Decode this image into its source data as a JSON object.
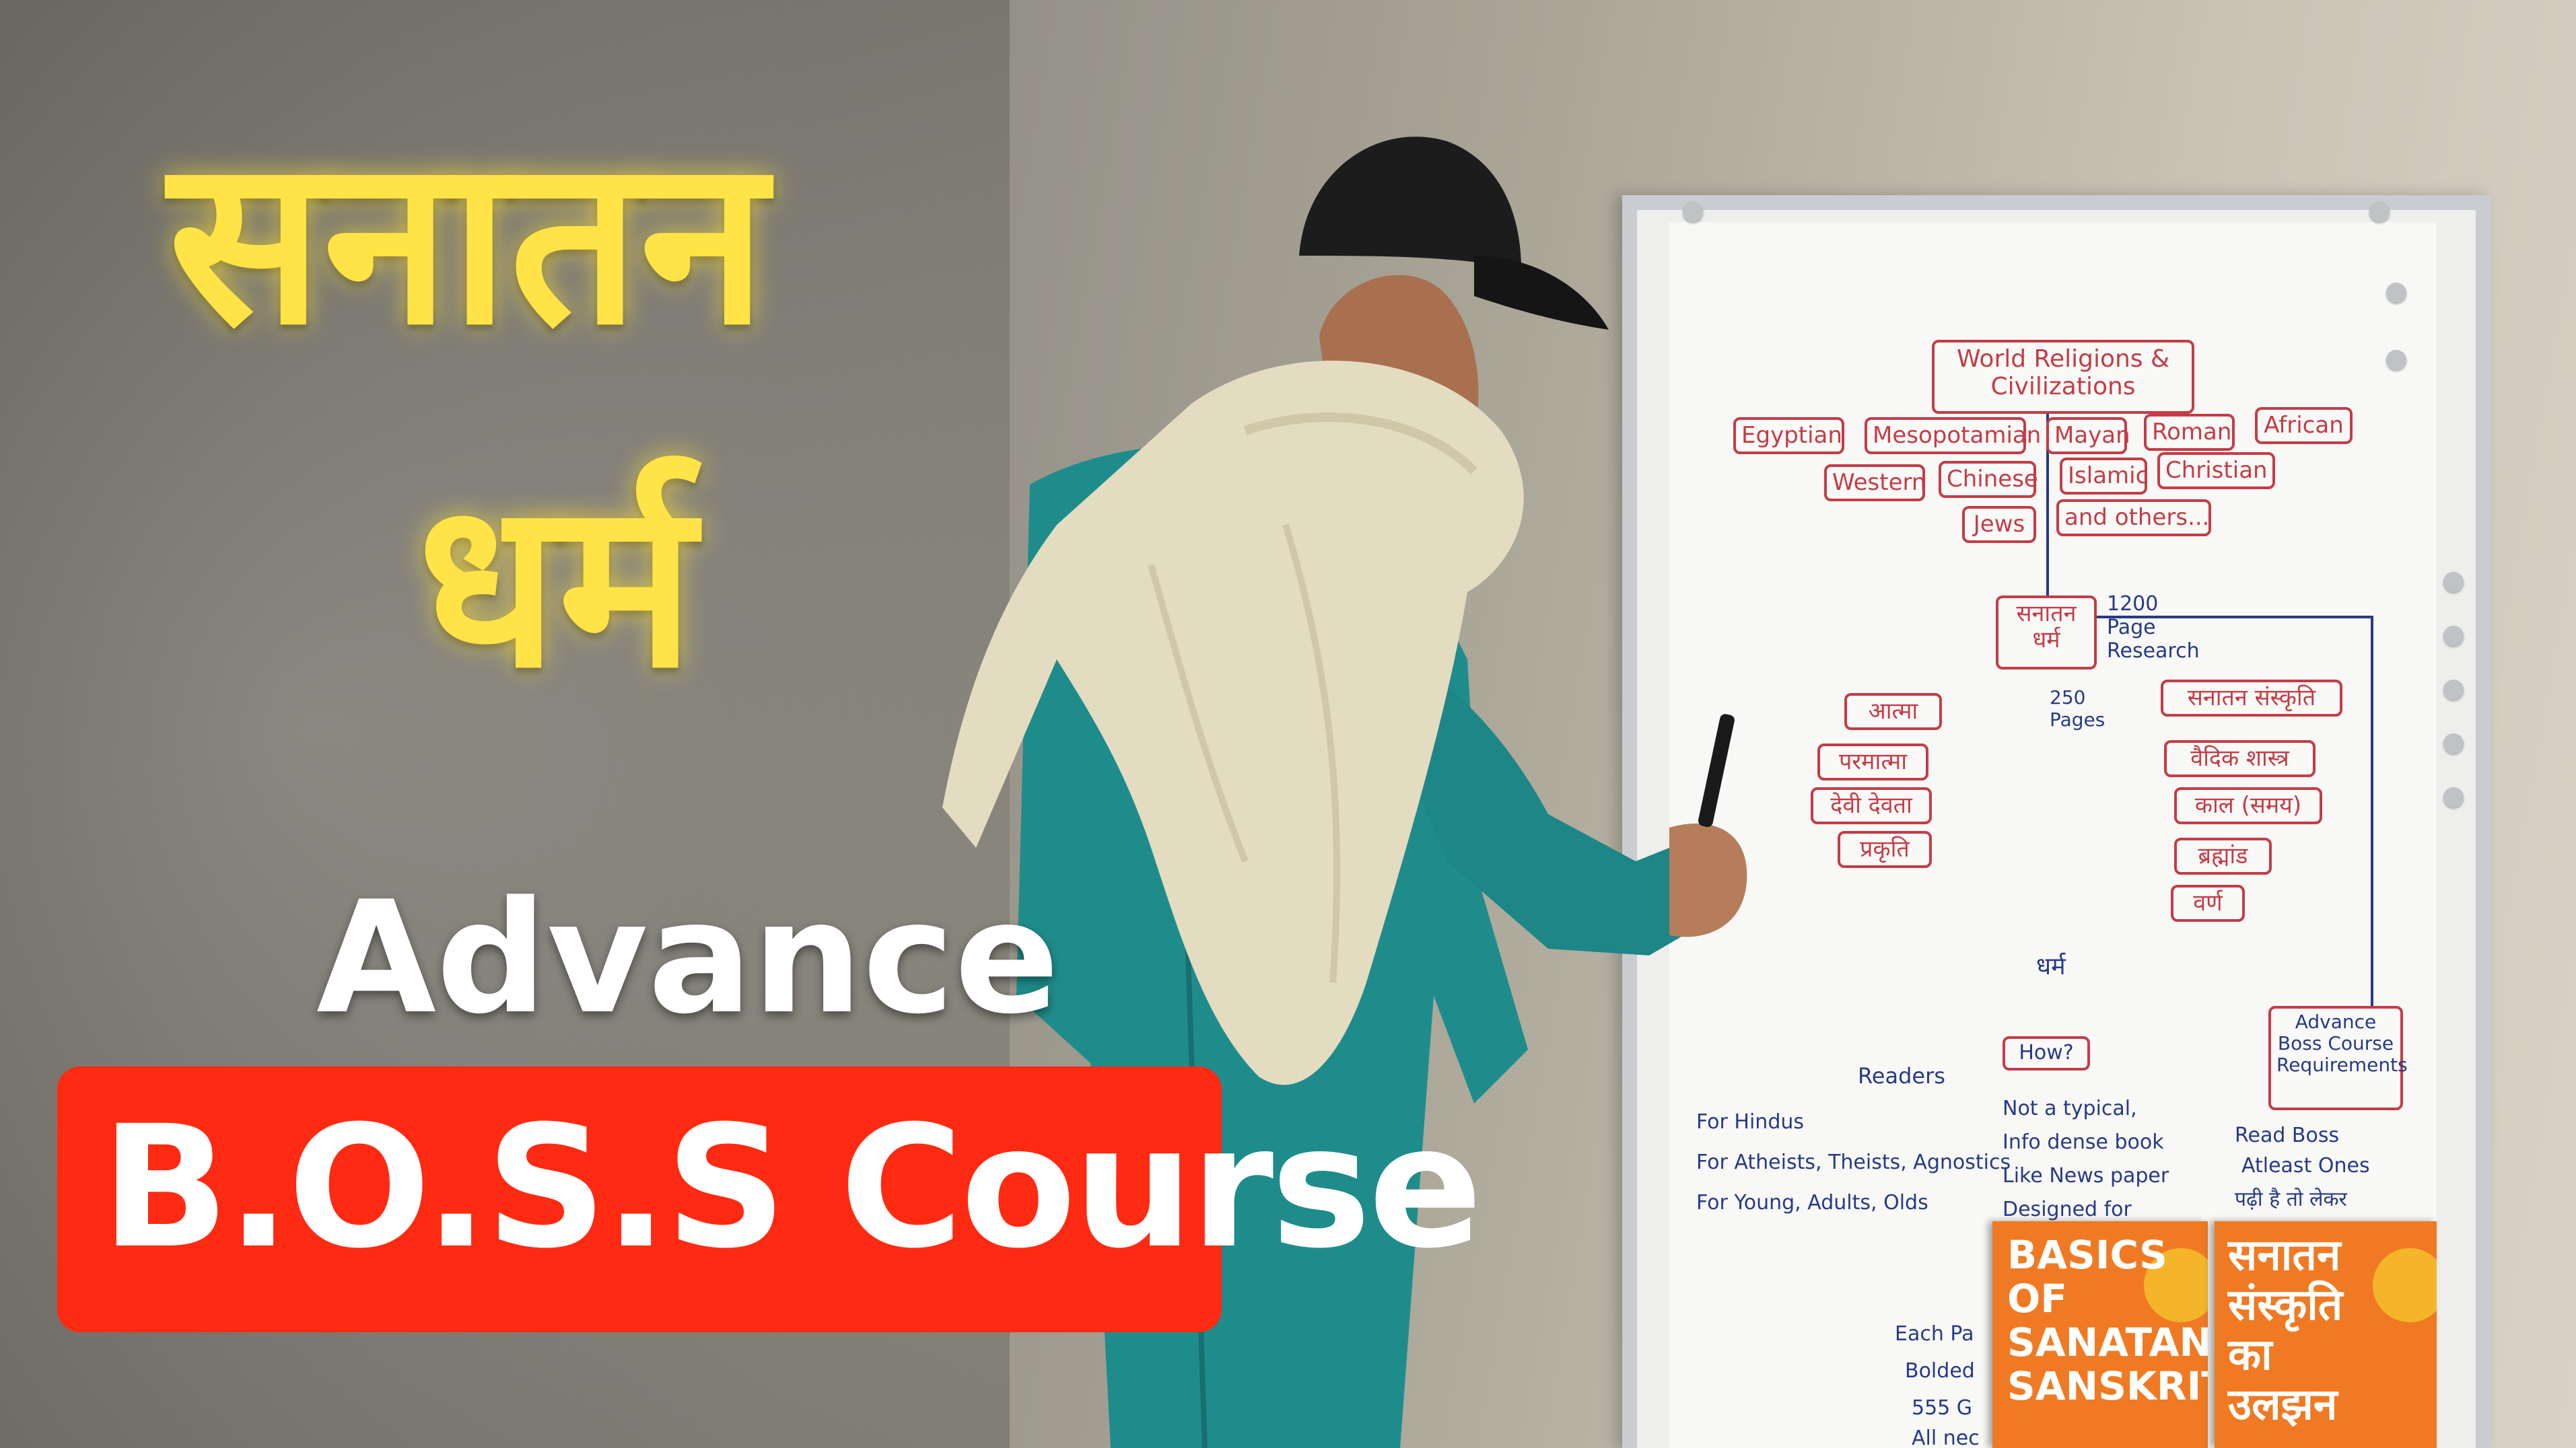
{
  "overlay": {
    "line1": "सनातन",
    "line2": "धर्म",
    "line3": "Advance",
    "line4": "B.O.S.S Course",
    "colors": {
      "headline": "#ffe347",
      "badge": "#ff2a12",
      "white": "#ffffff"
    }
  },
  "whiteboard": {
    "heading": "World Religions & Civilizations",
    "religions": [
      "Egyptian",
      "Mesopotamian",
      "Mayan",
      "Roman",
      "African",
      "Western",
      "Chinese",
      "Islamic",
      "Christian",
      "Jews",
      "and others..."
    ],
    "center": "सनातन धर्म",
    "research": "1200 Page Research",
    "pages": "250 Pages",
    "left_topics": [
      "आत्मा",
      "परमात्मा",
      "देवी देवता",
      "प्रकृति"
    ],
    "right_topics": [
      "सनातन संस्कृति",
      "वैदिक शास्त्र",
      "काल (समय)",
      "ब्रह्मांड",
      "वर्ण"
    ],
    "bottom_center": "धर्म",
    "advance_box": "Advance Boss Course Requirements",
    "readers": "Readers",
    "how": "How?",
    "audience": [
      "For Hindus",
      "For Atheists, Theists, Agnostics",
      "For Young, Adults, Olds"
    ],
    "how_points": [
      "Not a typical,",
      "Info dense book",
      "Like News paper",
      "Designed for"
    ],
    "req_points": [
      "Read Boss",
      "Atleast Ones",
      "पढ़ी है तो लेकर"
    ],
    "bottom_points": [
      "Each Pa",
      "Bolded",
      "555 G",
      "All nec"
    ]
  },
  "books": [
    {
      "title_lines": [
        "BASICS",
        "OF",
        "SANATAN",
        "SANSKRITI"
      ]
    },
    {
      "title_lines": [
        "सनातन",
        "संस्कृति",
        "का",
        "उलझन"
      ]
    }
  ]
}
